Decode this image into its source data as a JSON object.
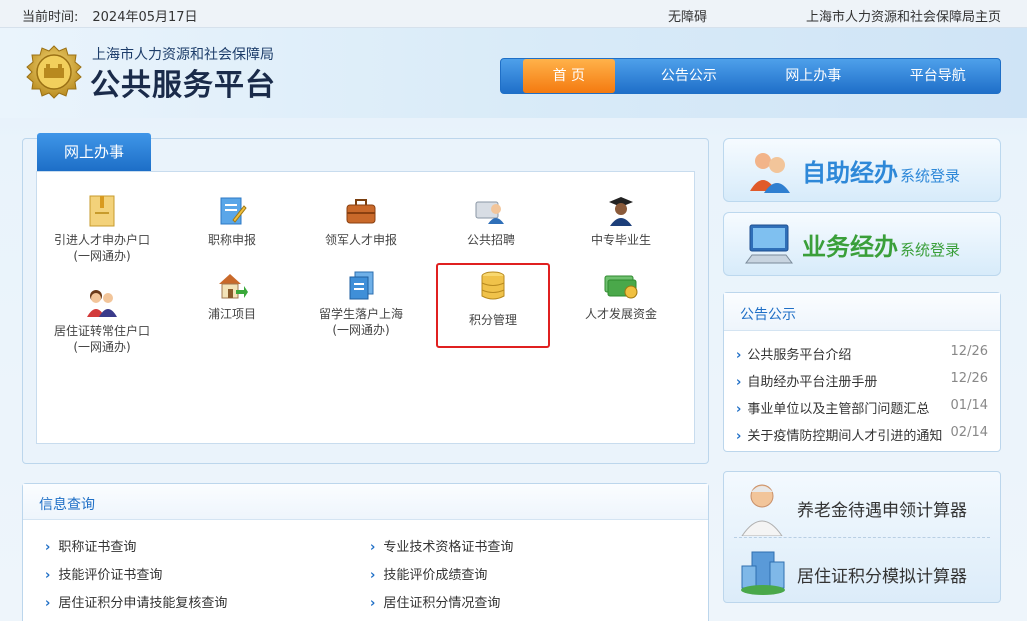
{
  "topbar": {
    "date_label": "当前时间:",
    "date_value": "2024年05月17日",
    "accessibility": "无障碍",
    "home_link": "上海市人力资源和社会保障局主页"
  },
  "header": {
    "subtitle": "上海市人力资源和社会保障局",
    "title": "公共服务平台",
    "nav": [
      {
        "label": "首 页",
        "active": true
      },
      {
        "label": "公告公示"
      },
      {
        "label": "网上办事"
      },
      {
        "label": "平台导航"
      }
    ]
  },
  "services": {
    "tab_label": "网上办事",
    "items": [
      {
        "label": "引进人才申办户口",
        "sub": "(一网通办)",
        "icon": "folder-icon"
      },
      {
        "label": "职称申报",
        "sub": "",
        "icon": "edit-document-icon"
      },
      {
        "label": "领军人才申报",
        "sub": "",
        "icon": "briefcase-icon"
      },
      {
        "label": "公共招聘",
        "sub": "",
        "icon": "recruit-icon"
      },
      {
        "label": "中专毕业生",
        "sub": "",
        "icon": "graduate-icon"
      },
      {
        "label": "居住证转常住户口",
        "sub": "(一网通办)",
        "icon": "family-icon"
      },
      {
        "label": "浦江项目",
        "sub": "",
        "icon": "house-arrow-icon"
      },
      {
        "label": "留学生落户上海",
        "sub": "(一网通办)",
        "icon": "documents-icon"
      },
      {
        "label": "积分管理",
        "sub": "",
        "icon": "database-icon"
      },
      {
        "label": "人才发展资金",
        "sub": "",
        "icon": "money-icon"
      }
    ]
  },
  "info": {
    "title": "信息查询",
    "links_left": [
      "职称证书查询",
      "技能评价证书查询",
      "居住证积分申请技能复核查询"
    ],
    "links_right": [
      "专业技术资格证书查询",
      "技能评价成绩查询",
      "居住证积分情况查询"
    ]
  },
  "login": {
    "self_big": "自助经办",
    "self_small": "系统登录",
    "biz_big": "业务经办",
    "biz_small": "系统登录"
  },
  "notice": {
    "title": "公告公示",
    "items": [
      {
        "text": "公共服务平台介绍",
        "date": "12/26"
      },
      {
        "text": "自助经办平台注册手册",
        "date": "12/26"
      },
      {
        "text": "事业单位以及主管部门问题汇总",
        "date": "01/14"
      },
      {
        "text": "关于疫情防控期间人才引进的通知",
        "date": "02/14"
      }
    ]
  },
  "calculators": {
    "pension": "养老金待遇申领计算器",
    "points": "居住证积分模拟计算器"
  }
}
